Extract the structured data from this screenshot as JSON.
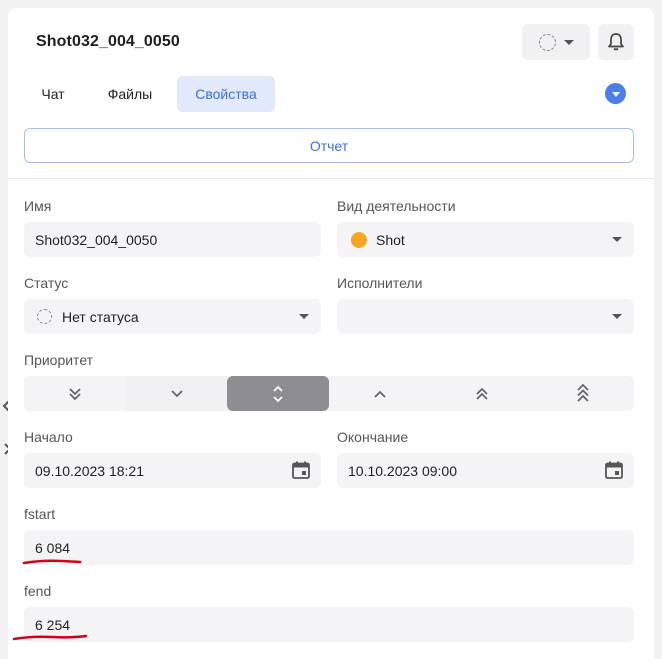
{
  "header": {
    "title": "Shot032_004_0050"
  },
  "tabs": [
    {
      "label": "Чат",
      "active": false
    },
    {
      "label": "Файлы",
      "active": false
    },
    {
      "label": "Свойства",
      "active": true
    }
  ],
  "report_button": "Отчет",
  "fields": {
    "name": {
      "label": "Имя",
      "value": "Shot032_004_0050"
    },
    "activity": {
      "label": "Вид деятельности",
      "value": "Shot",
      "color": "#f5a623"
    },
    "status": {
      "label": "Статус",
      "value": "Нет статуса"
    },
    "assignees": {
      "label": "Исполнители",
      "value": ""
    },
    "priority": {
      "label": "Приоритет",
      "options": [
        "lowest",
        "low",
        "normal",
        "high",
        "higher",
        "highest"
      ],
      "selected": "normal"
    },
    "start": {
      "label": "Начало",
      "value": "09.10.2023 18:21"
    },
    "end": {
      "label": "Окончание",
      "value": "10.10.2023 09:00"
    },
    "fstart": {
      "label": "fstart",
      "value": "6 084"
    },
    "fend": {
      "label": "fend",
      "value": "6 254"
    }
  },
  "colors": {
    "accent": "#3d6fd9",
    "tab_active_bg": "#e1e9fb",
    "priority_active_bg": "#8e8e92",
    "annotation_underline": "#d0021b"
  }
}
